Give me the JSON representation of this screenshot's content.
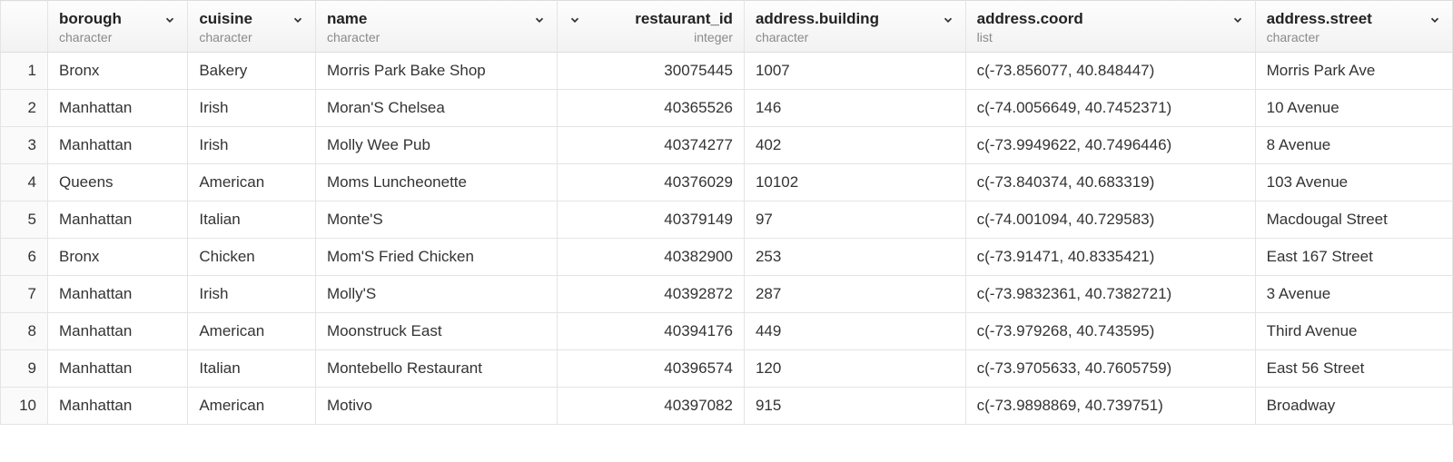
{
  "columns": [
    {
      "name": "borough",
      "type": "character",
      "align": "left"
    },
    {
      "name": "cuisine",
      "type": "character",
      "align": "left"
    },
    {
      "name": "name",
      "type": "character",
      "align": "left"
    },
    {
      "name": "restaurant_id",
      "type": "integer",
      "align": "right"
    },
    {
      "name": "address.building",
      "type": "character",
      "align": "left"
    },
    {
      "name": "address.coord",
      "type": "list",
      "align": "left"
    },
    {
      "name": "address.street",
      "type": "character",
      "align": "left"
    }
  ],
  "rows": [
    {
      "n": "1",
      "borough": "Bronx",
      "cuisine": "Bakery",
      "name": "Morris Park Bake Shop",
      "restaurant_id": "30075445",
      "building": "1007",
      "coord": "c(-73.856077, 40.848447)",
      "street": "Morris Park Ave"
    },
    {
      "n": "2",
      "borough": "Manhattan",
      "cuisine": "Irish",
      "name": "Moran'S Chelsea",
      "restaurant_id": "40365526",
      "building": "146",
      "coord": "c(-74.0056649, 40.7452371)",
      "street": "10 Avenue"
    },
    {
      "n": "3",
      "borough": "Manhattan",
      "cuisine": "Irish",
      "name": "Molly Wee Pub",
      "restaurant_id": "40374277",
      "building": "402",
      "coord": "c(-73.9949622, 40.7496446)",
      "street": "8 Avenue"
    },
    {
      "n": "4",
      "borough": "Queens",
      "cuisine": "American",
      "name": "Moms Luncheonette",
      "restaurant_id": "40376029",
      "building": "10102",
      "coord": "c(-73.840374, 40.683319)",
      "street": "103 Avenue"
    },
    {
      "n": "5",
      "borough": "Manhattan",
      "cuisine": "Italian",
      "name": "Monte'S",
      "restaurant_id": "40379149",
      "building": "97",
      "coord": "c(-74.001094, 40.729583)",
      "street": "Macdougal Street"
    },
    {
      "n": "6",
      "borough": "Bronx",
      "cuisine": "Chicken",
      "name": "Mom'S Fried Chicken",
      "restaurant_id": "40382900",
      "building": "253",
      "coord": "c(-73.91471, 40.8335421)",
      "street": "East  167 Street"
    },
    {
      "n": "7",
      "borough": "Manhattan",
      "cuisine": "Irish",
      "name": "Molly'S",
      "restaurant_id": "40392872",
      "building": "287",
      "coord": "c(-73.9832361, 40.7382721)",
      "street": "3 Avenue"
    },
    {
      "n": "8",
      "borough": "Manhattan",
      "cuisine": "American",
      "name": "Moonstruck East",
      "restaurant_id": "40394176",
      "building": "449",
      "coord": "c(-73.979268, 40.743595)",
      "street": "Third Avenue"
    },
    {
      "n": "9",
      "borough": "Manhattan",
      "cuisine": "Italian",
      "name": "Montebello Restaurant",
      "restaurant_id": "40396574",
      "building": "120",
      "coord": "c(-73.9705633, 40.7605759)",
      "street": "East   56 Street"
    },
    {
      "n": "10",
      "borough": "Manhattan",
      "cuisine": "American",
      "name": "Motivo",
      "restaurant_id": "40397082",
      "building": "915",
      "coord": "c(-73.9898869, 40.739751)",
      "street": "Broadway"
    }
  ]
}
